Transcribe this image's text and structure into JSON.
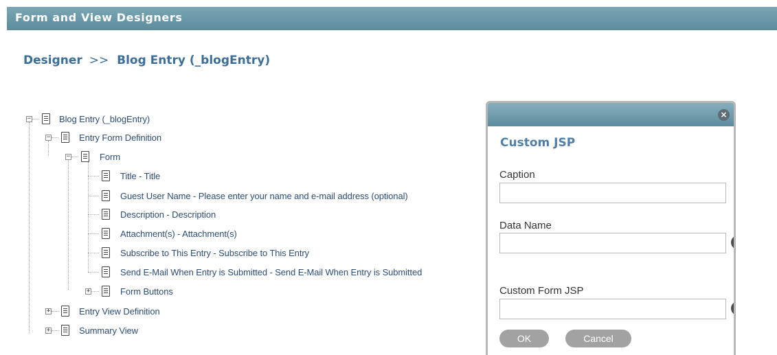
{
  "header": {
    "title": "Form and View Designers"
  },
  "breadcrumb": {
    "designer": "Designer",
    "separator": ">>",
    "current": "Blog Entry (_blogEntry)"
  },
  "tree": {
    "root": "Blog Entry (_blogEntry)",
    "entry_form_definition": "Entry Form Definition",
    "form": "Form",
    "items": [
      "Title - Title",
      "Guest User Name - Please enter your name and e-mail address (optional)",
      "Description - Description",
      "Attachment(s) - Attachment(s)",
      "Subscribe to This Entry - Subscribe to This Entry",
      "Send E-Mail When Entry is Submitted - Send E-Mail When Entry is Submitted"
    ],
    "form_buttons": "Form Buttons",
    "entry_view_definition": "Entry View Definition",
    "summary_view": "Summary View",
    "expander_minus": "−",
    "expander_plus": "+"
  },
  "dialog": {
    "close_glyph": "×",
    "title": "Custom JSP",
    "caption_label": "Caption",
    "caption_value": "",
    "data_name_label": "Data Name",
    "data_name_value": "",
    "custom_form_jsp_label": "Custom Form JSP",
    "custom_form_jsp_value": "",
    "help_glyph": "?",
    "ok_label": "OK",
    "cancel_label": "Cancel"
  }
}
